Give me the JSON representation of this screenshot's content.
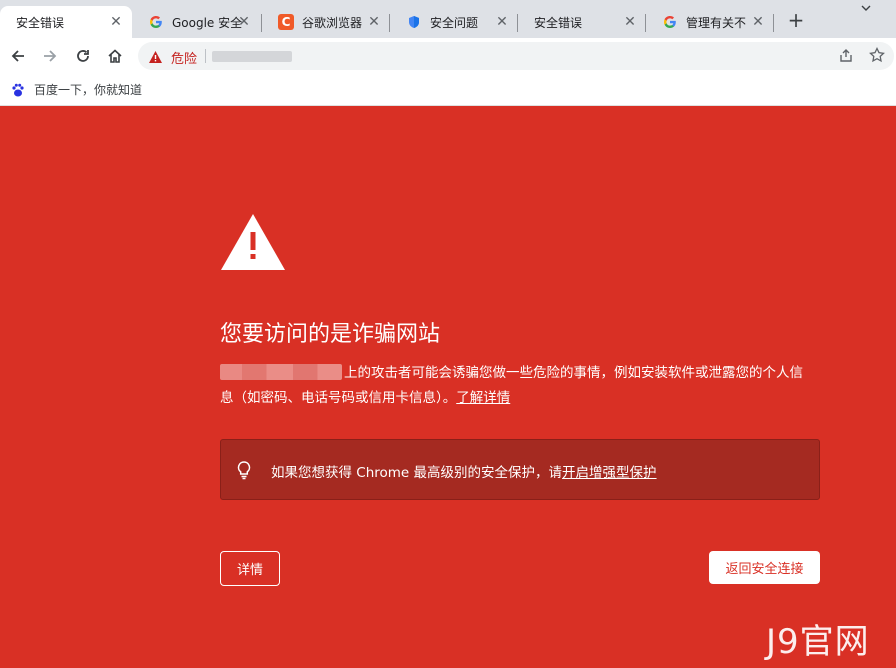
{
  "tabs": [
    {
      "title": "安全错误",
      "icon": "warning-icon",
      "active": true
    },
    {
      "title": "Google 安全",
      "icon": "google-icon"
    },
    {
      "title": "谷歌浏览器",
      "icon": "c-logo-icon"
    },
    {
      "title": "安全问题",
      "icon": "shield-icon"
    },
    {
      "title": "安全错误",
      "icon": "none"
    },
    {
      "title": "管理有关不",
      "icon": "google-icon"
    }
  ],
  "omnibox": {
    "security_label": "危险"
  },
  "bookmarks": [
    {
      "label": "百度一下，你就知道",
      "icon": "baidu-paw-icon"
    }
  ],
  "interstitial": {
    "heading": "您要访问的是诈骗网站",
    "body_after_url": "上的攻击者可能会诱骗您做一些危险的事情，例如安装软件或泄露您的个人信息（如密码、电话号码或信用卡信息）。",
    "learn_more": "了解详情",
    "tip_prefix": "如果您想获得 Chrome 最高级别的安全保护，请",
    "tip_link": "开启增强型保护",
    "details_button": "详情",
    "back_button": "返回安全连接"
  },
  "watermark": "J9官网",
  "colors": {
    "danger_red": "#d93025",
    "tip_box": "#a52a21",
    "toolbar": "#ffffff",
    "tabstrip": "#dee1e6"
  }
}
